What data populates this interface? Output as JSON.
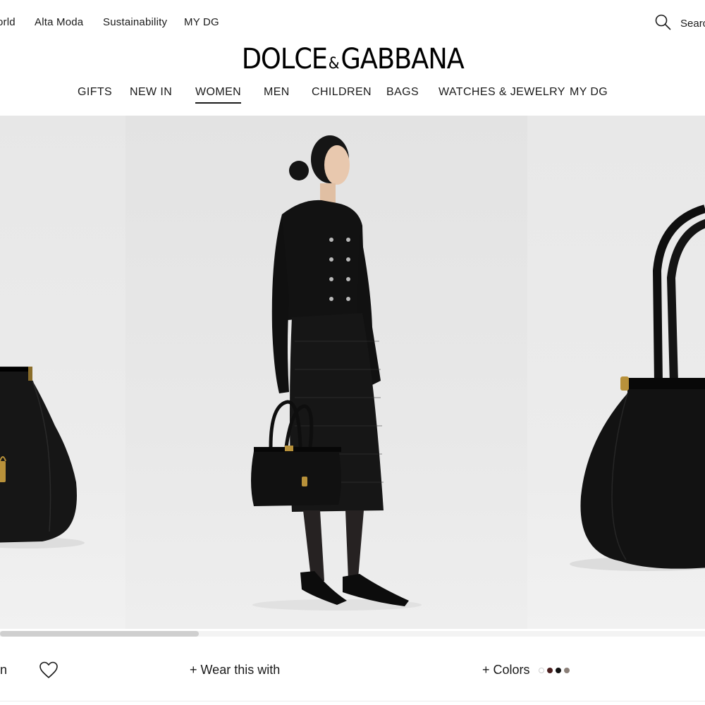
{
  "utility_nav": {
    "items": [
      {
        "label": "orld"
      },
      {
        "label": "Alta Moda"
      },
      {
        "label": "Sustainability"
      },
      {
        "label": "MY DG"
      }
    ],
    "search_label": "Searc",
    "search_icon": "search-icon"
  },
  "brand": {
    "name_left": "DOLCE",
    "amp": "&",
    "name_right": "GABBANA"
  },
  "main_nav": {
    "items": [
      {
        "label": "GIFTS"
      },
      {
        "label": "NEW IN"
      },
      {
        "label": "WOMEN",
        "active": true
      },
      {
        "label": "MEN"
      },
      {
        "label": "CHILDREN"
      },
      {
        "label": "BAGS"
      },
      {
        "label": "WATCHES & JEWELRY"
      },
      {
        "label": "MY DG"
      }
    ]
  },
  "gallery": {
    "images": [
      {
        "subject": "black leather handbag, side view, partially visible"
      },
      {
        "subject": "model in black crochet outfit holding black handbag"
      },
      {
        "subject": "black leather handbag with tall handles, close-up"
      }
    ]
  },
  "action_bar": {
    "partial_label": "in",
    "heart_icon": "heart-icon",
    "wear_with": "+ Wear this with",
    "colors_label": "+ Colors",
    "swatches": [
      {
        "color": "#ffffff",
        "selected": false
      },
      {
        "color": "#4a1f1f",
        "selected": false
      },
      {
        "color": "#111111",
        "selected": true
      },
      {
        "color": "#8a7f78",
        "selected": false
      }
    ]
  }
}
